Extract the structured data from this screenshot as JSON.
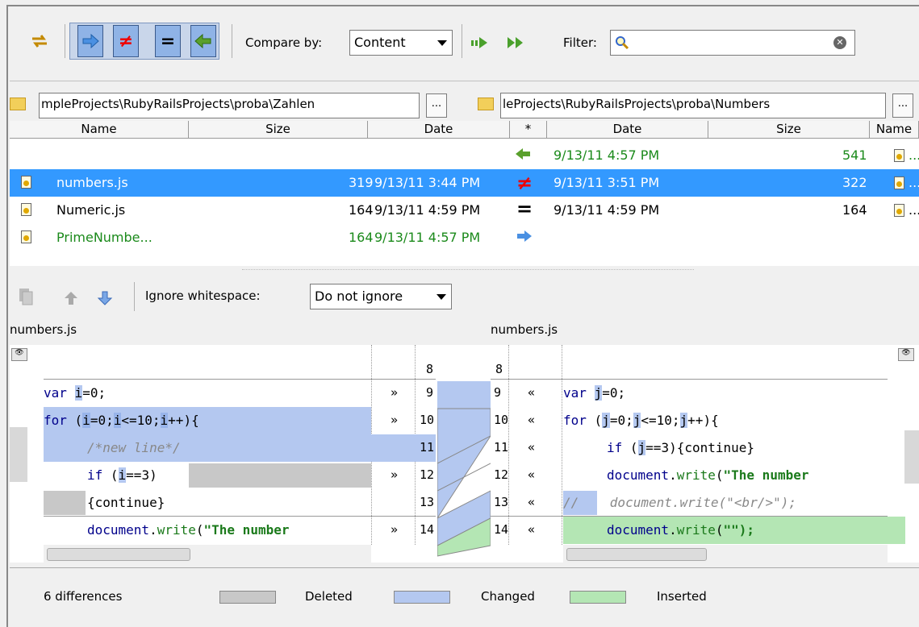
{
  "toolbar": {
    "compare_by_label": "Compare by:",
    "compare_by_value": "Content",
    "filter_label": "Filter:",
    "filter_value": ""
  },
  "paths": {
    "left": "mpleProjects\\RubyRailsProjects\\proba\\Zahlen",
    "right": "leProjects\\RubyRailsProjects\\proba\\Numbers",
    "browse_label": "..."
  },
  "file_table": {
    "headers": [
      "Name",
      "Size",
      "Date",
      "*",
      "Date",
      "Size",
      "Name"
    ],
    "rows": [
      {
        "name": "",
        "size_left": "",
        "date_left": "",
        "status": "left-arrow",
        "date_right": "9/13/11 4:57 PM",
        "size_right": "541",
        "name_right": "..."
      },
      {
        "name": "numbers.js",
        "size_left": "319",
        "date_left": "9/13/11 3:44 PM",
        "status": "not-equal",
        "date_right": "9/13/11 3:51 PM",
        "size_right": "322",
        "name_right": "..."
      },
      {
        "name": "Numeric.js",
        "size_left": "164",
        "date_left": "9/13/11 4:59 PM",
        "status": "equal",
        "date_right": "9/13/11 4:59 PM",
        "size_right": "164",
        "name_right": "..."
      },
      {
        "name": "PrimeNumbe...",
        "size_left": "164",
        "date_left": "9/13/11 4:57 PM",
        "status": "right-arrow",
        "date_right": "",
        "size_right": "",
        "name_right": ""
      }
    ]
  },
  "diff_toolbar": {
    "ignore_label": "Ignore whitespace:",
    "ignore_value": "Do not ignore"
  },
  "diff": {
    "left_title": "numbers.js",
    "right_title": "numbers.js",
    "left_lines": [
      {
        "n": "8",
        "code": ""
      },
      {
        "n": "9",
        "code": "var i=0;"
      },
      {
        "n": "10",
        "code": "for (i=0;i<=10;i++){"
      },
      {
        "n": "11",
        "code": "    /*new line*/"
      },
      {
        "n": "12",
        "code": "    if (i==3)"
      },
      {
        "n": "13",
        "code": "    {continue}"
      },
      {
        "n": "14",
        "code": "    document.write(\"The number"
      }
    ],
    "right_lines": [
      {
        "n": "8",
        "code": ""
      },
      {
        "n": "9",
        "code": "var j=0;"
      },
      {
        "n": "10",
        "code": "for (j=0;j<=10;j++){"
      },
      {
        "n": "11",
        "code": "    if (j==3){continue}"
      },
      {
        "n": "12",
        "code": "    document.write(\"The number"
      },
      {
        "n": "13",
        "code": "//    document.write(\"<br/>\");"
      },
      {
        "n": "14",
        "code": "    document.write(\"\");"
      }
    ]
  },
  "status": {
    "differences": "6 differences",
    "deleted": "Deleted",
    "changed": "Changed",
    "inserted": "Inserted"
  },
  "colors": {
    "deleted": "#c8c8c8",
    "changed": "#b4c8f0",
    "inserted": "#b4e6b4",
    "selection": "#3399ff"
  }
}
